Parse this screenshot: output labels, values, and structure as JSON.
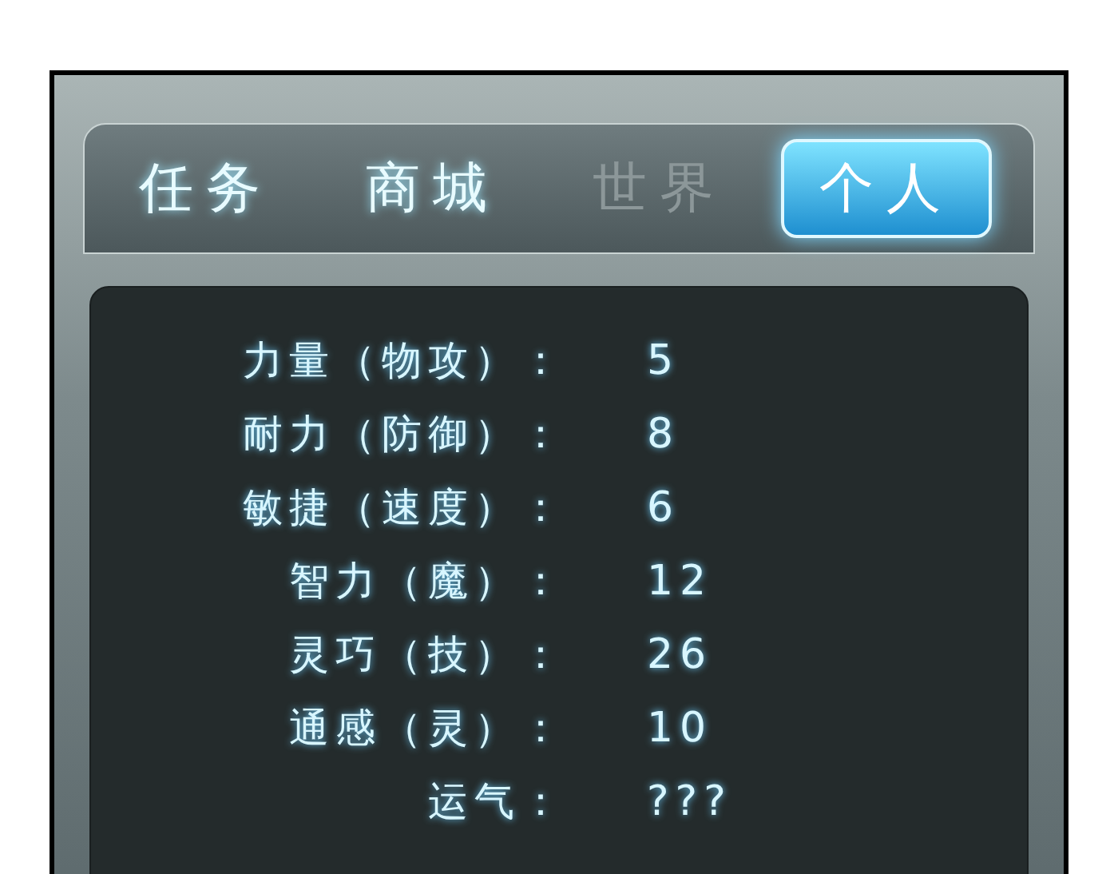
{
  "tabs": [
    {
      "label": "任务",
      "selected": false,
      "disabled": false
    },
    {
      "label": "商城",
      "selected": false,
      "disabled": false
    },
    {
      "label": "世界",
      "selected": false,
      "disabled": true
    },
    {
      "label": "个人",
      "selected": true,
      "disabled": false
    }
  ],
  "stats": [
    {
      "label": "力量（物攻）：",
      "value": "5"
    },
    {
      "label": "耐力（防御）：",
      "value": "8"
    },
    {
      "label": "敏捷（速度）：",
      "value": "6"
    },
    {
      "label": "智力（魔）：",
      "value": "12"
    },
    {
      "label": "灵巧（技）：",
      "value": "26"
    },
    {
      "label": "通感（灵）：",
      "value": "10"
    },
    {
      "label": "运气：",
      "value": "???"
    }
  ]
}
